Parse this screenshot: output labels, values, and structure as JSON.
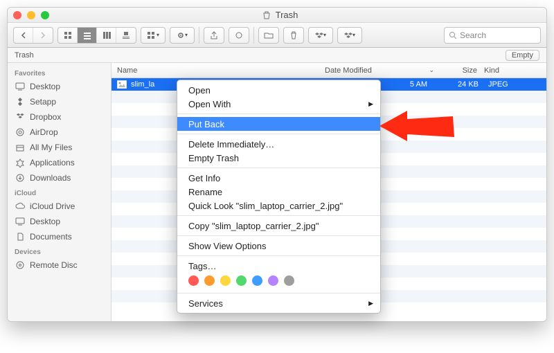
{
  "title": "Trash",
  "search_placeholder": "Search",
  "locbar_title": "Trash",
  "empty_label": "Empty",
  "columns": {
    "name": "Name",
    "date": "Date Modified",
    "size": "Size",
    "kind": "Kind"
  },
  "sidebar": {
    "groups": [
      {
        "head": "Favorites",
        "items": [
          {
            "icon": "monitor",
            "label": "Desktop"
          },
          {
            "icon": "setapp",
            "label": "Setapp"
          },
          {
            "icon": "dropbox",
            "label": "Dropbox"
          },
          {
            "icon": "airdrop",
            "label": "AirDrop"
          },
          {
            "icon": "allfiles",
            "label": "All My Files"
          },
          {
            "icon": "apps",
            "label": "Applications"
          },
          {
            "icon": "downloads",
            "label": "Downloads"
          }
        ]
      },
      {
        "head": "iCloud",
        "items": [
          {
            "icon": "cloud",
            "label": "iCloud Drive"
          },
          {
            "icon": "monitor",
            "label": "Desktop"
          },
          {
            "icon": "docs",
            "label": "Documents"
          }
        ]
      },
      {
        "head": "Devices",
        "items": [
          {
            "icon": "disc",
            "label": "Remote Disc"
          }
        ]
      }
    ]
  },
  "file": {
    "name": "slim_la",
    "date": "5 AM",
    "size": "24 KB",
    "kind": "JPEG"
  },
  "context": {
    "open": "Open",
    "open_with": "Open With",
    "put_back": "Put Back",
    "delete_immediately": "Delete Immediately…",
    "empty_trash": "Empty Trash",
    "get_info": "Get Info",
    "rename": "Rename",
    "quick_look": "Quick Look \"slim_laptop_carrier_2.jpg\"",
    "copy": "Copy \"slim_laptop_carrier_2.jpg\"",
    "show_view_options": "Show View Options",
    "tags": "Tags…",
    "services": "Services"
  },
  "tag_colors": [
    "#ff5b54",
    "#ff9b2e",
    "#ffd63d",
    "#53d76f",
    "#3f9dff",
    "#b583ff",
    "#9e9e9e"
  ]
}
